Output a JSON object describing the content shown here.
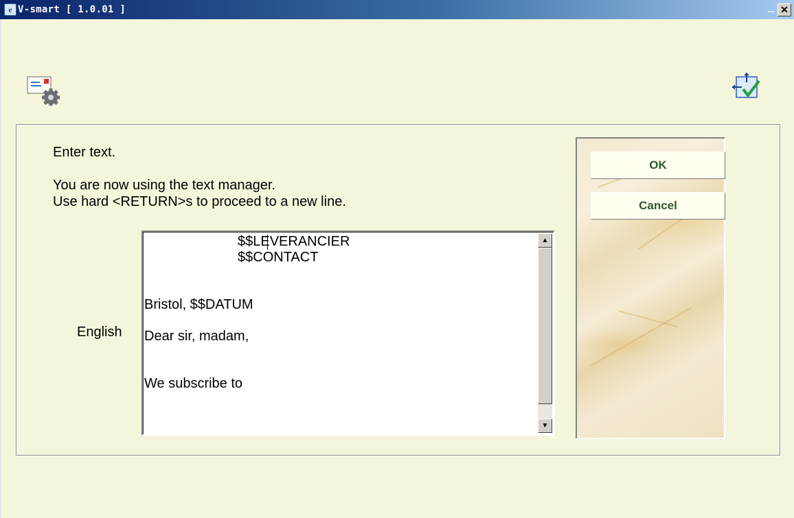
{
  "window": {
    "title": "V-smart [ 1.0.01 ]",
    "title_extra": "...",
    "close_glyph": "✕",
    "app_icon_glyph": "e"
  },
  "toolbar": {
    "left_icon": "mail-settings-icon",
    "right_icon": "fit-window-check-icon"
  },
  "dialog": {
    "heading": "Enter text.",
    "info_line1": "You are now using the text manager.",
    "info_line2": "Use hard <RETURN>s to proceed to a new line.",
    "language_label": "English",
    "text_lines": [
      "$$LEVERANCIER",
      "$$CONTACT",
      "",
      "",
      "Bristol, $$DATUM",
      "",
      "Dear sir, madam,",
      "",
      "",
      "We subscribe to"
    ],
    "ok_label": "OK",
    "cancel_label": "Cancel"
  },
  "colors": {
    "background": "#f5f5dc",
    "button_text": "#2d5a2d",
    "title_bar": "#0a246a"
  }
}
